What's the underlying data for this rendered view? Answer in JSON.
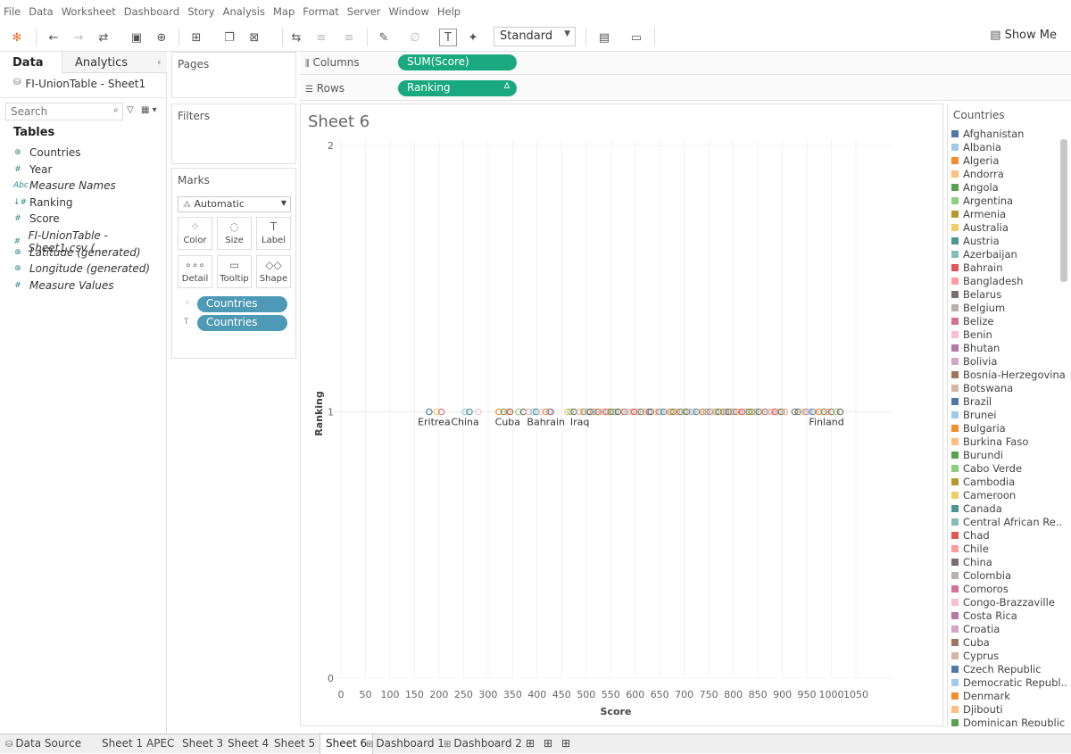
{
  "menu": [
    "File",
    "Data",
    "Worksheet",
    "Dashboard",
    "Story",
    "Analysis",
    "Map",
    "Format",
    "Server",
    "Window",
    "Help"
  ],
  "toolbar": {
    "fit_select": "Standard",
    "show_me": "Show Me"
  },
  "left_pane": {
    "tab_data": "Data",
    "tab_analytics": "Analytics",
    "datasource": "FI-UnionTable - Sheet1",
    "search_placeholder": "Search",
    "tables_header": "Tables",
    "fields": [
      {
        "icon": "⊕",
        "name": "Countries",
        "italic": false
      },
      {
        "icon": "#",
        "name": "Year",
        "italic": false
      },
      {
        "icon": "Abc",
        "name": "Measure Names",
        "italic": true
      },
      {
        "icon": "↓#",
        "name": "Ranking",
        "italic": false
      },
      {
        "icon": "#",
        "name": "Score",
        "italic": false
      },
      {
        "icon": "#",
        "name": "FI-UnionTable - Sheet1.csv (...",
        "italic": true
      },
      {
        "icon": "⊕",
        "name": "Latitude (generated)",
        "italic": true
      },
      {
        "icon": "⊕",
        "name": "Longitude (generated)",
        "italic": true
      },
      {
        "icon": "#",
        "name": "Measure Values",
        "italic": true
      }
    ]
  },
  "cards": {
    "pages": "Pages",
    "filters": "Filters",
    "marks": "Marks",
    "mark_type": "Automatic",
    "mark_buttons": [
      "Color",
      "Size",
      "Label",
      "Detail",
      "Tooltip",
      "Shape"
    ],
    "mark_pills": [
      "Countries",
      "Countries"
    ]
  },
  "shelves": {
    "columns_label": "Columns",
    "columns_pill": "SUM(Score)",
    "rows_label": "Rows",
    "rows_pill": "Ranking",
    "rows_pill_icon": "Δ"
  },
  "sheet": {
    "title": "Sheet 6"
  },
  "chart_data": {
    "type": "scatter",
    "xlabel": "Score",
    "ylabel": "Ranking",
    "xlim": [
      0,
      1070
    ],
    "ylim": [
      0,
      2
    ],
    "x_ticks": [
      0,
      50,
      100,
      150,
      200,
      250,
      300,
      350,
      400,
      450,
      500,
      550,
      600,
      650,
      700,
      750,
      800,
      850,
      900,
      950,
      1000,
      1050
    ],
    "y_ticks": [
      0,
      1,
      2
    ],
    "points_y": 1,
    "points_x": [
      180,
      195,
      205,
      253,
      262,
      280,
      322,
      332,
      340,
      345,
      362,
      372,
      383,
      392,
      398,
      408,
      418,
      425,
      428,
      462,
      468,
      475,
      487,
      495,
      503,
      508,
      515,
      522,
      525,
      530,
      540,
      545,
      550,
      555,
      560,
      565,
      572,
      578,
      585,
      592,
      598,
      605,
      612,
      620,
      628,
      632,
      640,
      648,
      652,
      658,
      665,
      672,
      678,
      685,
      692,
      700,
      705,
      712,
      718,
      725,
      732,
      738,
      745,
      752,
      758,
      765,
      770,
      775,
      780,
      785,
      790,
      795,
      800,
      805,
      812,
      818,
      825,
      832,
      838,
      845,
      852,
      858,
      865,
      872,
      878,
      885,
      892,
      898,
      905,
      925,
      932,
      940,
      948,
      955,
      962,
      968,
      975,
      985,
      992,
      1000,
      1010,
      1018
    ],
    "annotations": [
      {
        "label": "Eritrea",
        "x": 190
      },
      {
        "label": "China",
        "x": 253
      },
      {
        "label": "Cuba",
        "x": 340
      },
      {
        "label": "Bahrain",
        "x": 418
      },
      {
        "label": "Iraq",
        "x": 487
      },
      {
        "label": "Finland",
        "x": 990
      }
    ]
  },
  "legend": {
    "title": "Countries",
    "items": [
      {
        "name": "Afghanistan",
        "color": "#4e79a7"
      },
      {
        "name": "Albania",
        "color": "#a0cbe8"
      },
      {
        "name": "Algeria",
        "color": "#f28e2b"
      },
      {
        "name": "Andorra",
        "color": "#ffbe7d"
      },
      {
        "name": "Angola",
        "color": "#59a14f"
      },
      {
        "name": "Argentina",
        "color": "#8cd17d"
      },
      {
        "name": "Armenia",
        "color": "#b6992d"
      },
      {
        "name": "Australia",
        "color": "#f1ce63"
      },
      {
        "name": "Austria",
        "color": "#499894"
      },
      {
        "name": "Azerbaijan",
        "color": "#86bcb6"
      },
      {
        "name": "Bahrain",
        "color": "#e15759"
      },
      {
        "name": "Bangladesh",
        "color": "#ff9d9a"
      },
      {
        "name": "Belarus",
        "color": "#79706e"
      },
      {
        "name": "Belgium",
        "color": "#bab0ac"
      },
      {
        "name": "Belize",
        "color": "#d37295"
      },
      {
        "name": "Benin",
        "color": "#fabfd2"
      },
      {
        "name": "Bhutan",
        "color": "#b07aa1"
      },
      {
        "name": "Bolivia",
        "color": "#d4a6c8"
      },
      {
        "name": "Bosnia-Herzegovina",
        "color": "#9d7660"
      },
      {
        "name": "Botswana",
        "color": "#d7b5a6"
      },
      {
        "name": "Brazil",
        "color": "#4e79a7"
      },
      {
        "name": "Brunei",
        "color": "#a0cbe8"
      },
      {
        "name": "Bulgaria",
        "color": "#f28e2b"
      },
      {
        "name": "Burkina Faso",
        "color": "#ffbe7d"
      },
      {
        "name": "Burundi",
        "color": "#59a14f"
      },
      {
        "name": "Cabo Verde",
        "color": "#8cd17d"
      },
      {
        "name": "Cambodia",
        "color": "#b6992d"
      },
      {
        "name": "Cameroon",
        "color": "#f1ce63"
      },
      {
        "name": "Canada",
        "color": "#499894"
      },
      {
        "name": "Central African Re..",
        "color": "#86bcb6"
      },
      {
        "name": "Chad",
        "color": "#e15759"
      },
      {
        "name": "Chile",
        "color": "#ff9d9a"
      },
      {
        "name": "China",
        "color": "#79706e"
      },
      {
        "name": "Colombia",
        "color": "#bab0ac"
      },
      {
        "name": "Comoros",
        "color": "#d37295"
      },
      {
        "name": "Congo-Brazzaville",
        "color": "#fabfd2"
      },
      {
        "name": "Costa Rica",
        "color": "#b07aa1"
      },
      {
        "name": "Croatia",
        "color": "#d4a6c8"
      },
      {
        "name": "Cuba",
        "color": "#9d7660"
      },
      {
        "name": "Cyprus",
        "color": "#d7b5a6"
      },
      {
        "name": "Czech Republic",
        "color": "#4e79a7"
      },
      {
        "name": "Democratic Republ..",
        "color": "#a0cbe8"
      },
      {
        "name": "Denmark",
        "color": "#f28e2b"
      },
      {
        "name": "Djibouti",
        "color": "#ffbe7d"
      },
      {
        "name": "Dominican Republic",
        "color": "#59a14f"
      }
    ]
  },
  "bottom_tabs": [
    {
      "label": "Data Source",
      "icon": "⛁"
    },
    {
      "label": "Sheet 1"
    },
    {
      "label": "APEC"
    },
    {
      "label": "Sheet 3"
    },
    {
      "label": "Sheet 4"
    },
    {
      "label": "Sheet 5"
    },
    {
      "label": "Sheet 6",
      "active": true
    },
    {
      "label": "Dashboard 1",
      "icon": "⊞"
    },
    {
      "label": "Dashboard 2",
      "icon": "⊞"
    }
  ]
}
